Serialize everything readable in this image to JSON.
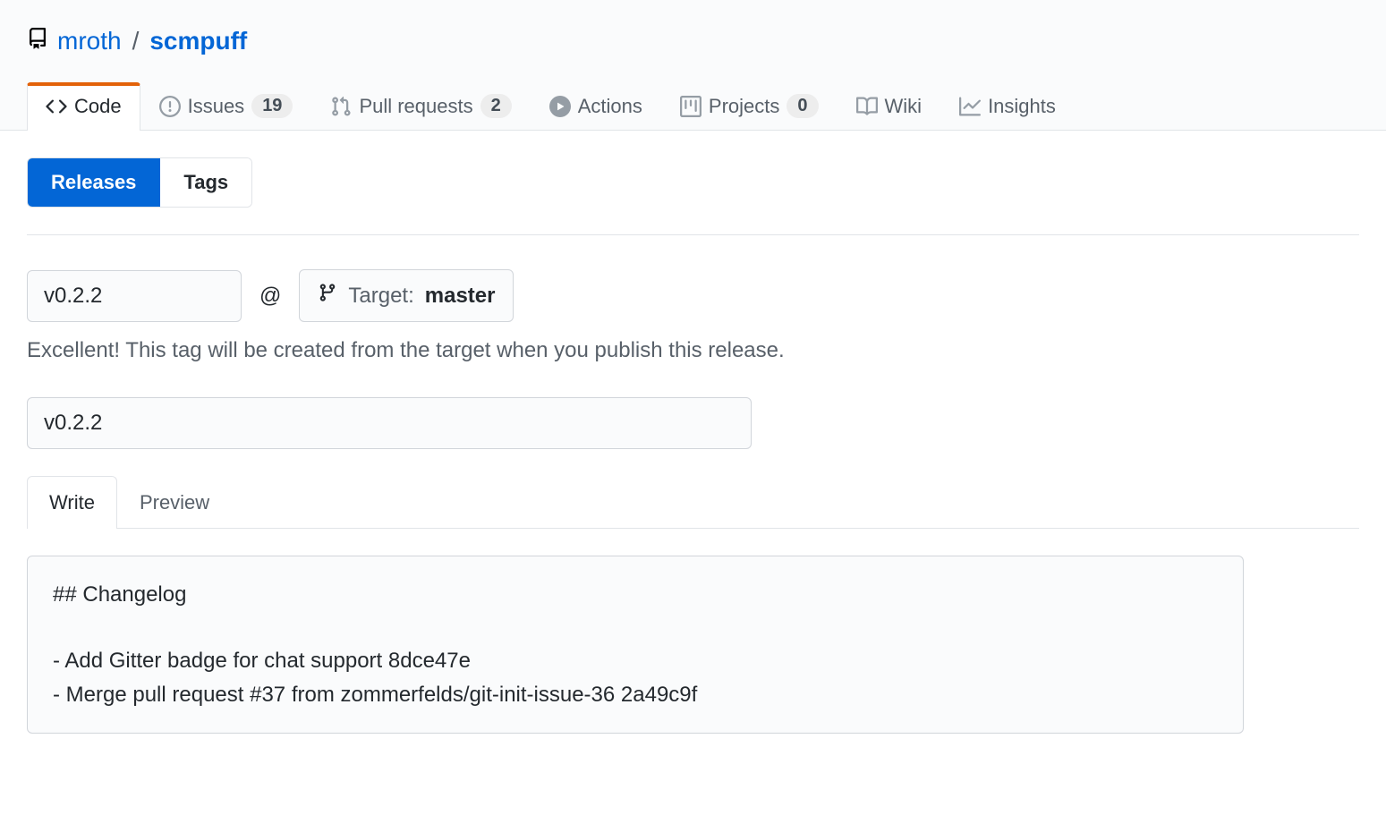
{
  "repo": {
    "owner": "mroth",
    "name": "scmpuff"
  },
  "tabs": [
    {
      "id": "code",
      "label": "Code",
      "count": null,
      "selected": true
    },
    {
      "id": "issues",
      "label": "Issues",
      "count": "19",
      "selected": false
    },
    {
      "id": "prs",
      "label": "Pull requests",
      "count": "2",
      "selected": false
    },
    {
      "id": "actions",
      "label": "Actions",
      "count": null,
      "selected": false
    },
    {
      "id": "projects",
      "label": "Projects",
      "count": "0",
      "selected": false
    },
    {
      "id": "wiki",
      "label": "Wiki",
      "count": null,
      "selected": false
    },
    {
      "id": "insights",
      "label": "Insights",
      "count": null,
      "selected": false
    }
  ],
  "subnav": {
    "releases": "Releases",
    "tags": "Tags"
  },
  "release": {
    "tag_value": "v0.2.2",
    "at": "@",
    "target_label": "Target:",
    "target_value": "master",
    "tag_note": "Excellent! This tag will be created from the target when you publish this release.",
    "title_value": "v0.2.2"
  },
  "editor": {
    "write": "Write",
    "preview": "Preview",
    "body": "## Changelog\n\n- Add Gitter badge for chat support 8dce47e\n- Merge pull request #37 from zommerfelds/git-init-issue-36 2a49c9f"
  }
}
